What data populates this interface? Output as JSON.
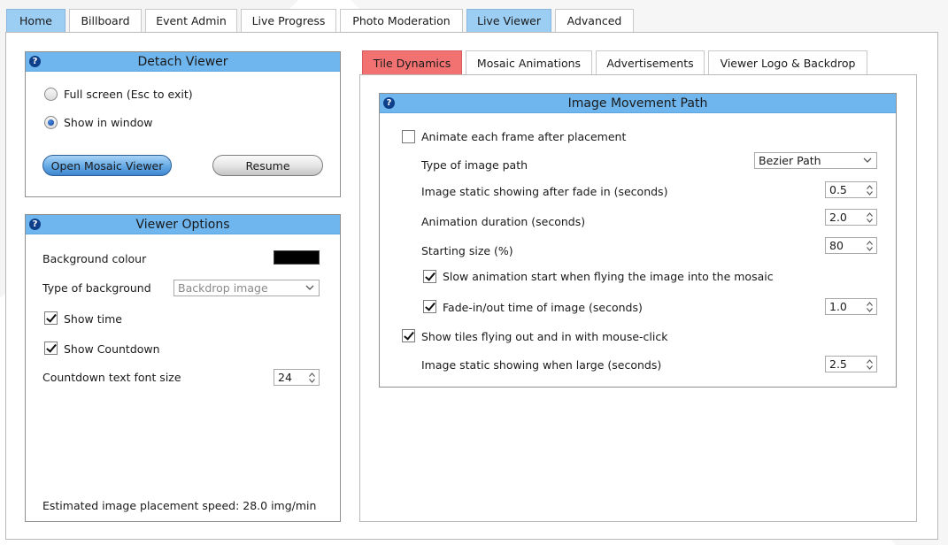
{
  "main_tabs": [
    "Home",
    "Billboard",
    "Event Admin",
    "Live Progress",
    "Photo Moderation",
    "Live Viewer",
    "Advanced"
  ],
  "active_main_tab": "Live Viewer",
  "help_glyph": "?",
  "detach_viewer": {
    "title": "Detach Viewer",
    "radio_fullscreen": "Full screen (Esc to exit)",
    "radio_window": "Show in window",
    "selected": "Show in window",
    "open_button": "Open Mosaic Viewer",
    "resume_button": "Resume"
  },
  "viewer_options": {
    "title": "Viewer Options",
    "background_colour_label": "Background colour",
    "background_colour": "#000000",
    "background_type_label": "Type of background",
    "background_type_value": "Backdrop image",
    "show_time_label": "Show time",
    "show_time": true,
    "show_countdown_label": "Show Countdown",
    "show_countdown": true,
    "font_size_label": "Countdown text font size",
    "font_size": "24",
    "speed_text": "Estimated image placement speed: 28.0 img/min"
  },
  "sub_tabs": [
    "Tile Dynamics",
    "Mosaic Animations",
    "Advertisements",
    "Viewer Logo & Backdrop"
  ],
  "active_sub_tab": "Tile Dynamics",
  "image_movement": {
    "title": "Image Movement Path",
    "animate_label": "Animate each frame after placement",
    "animate": false,
    "path_type_label": "Type of image path",
    "path_type_value": "Bezier Path",
    "static_after_fade_label": "Image static showing after fade in (seconds)",
    "static_after_fade": "0.5",
    "duration_label": "Animation duration (seconds)",
    "duration": "2.0",
    "starting_size_label": "Starting size (%)",
    "starting_size": "80",
    "slow_start_label": "Slow animation start when flying the image into the mosaic",
    "slow_start": true,
    "fade_label": "Fade-in/out time of image (seconds)",
    "fade": true,
    "fade_value": "1.0",
    "mouse_click_label": "Show tiles flying out and in with mouse-click",
    "mouse_click": true,
    "static_large_label": "Image static showing when large (seconds)",
    "static_large": "2.5"
  }
}
